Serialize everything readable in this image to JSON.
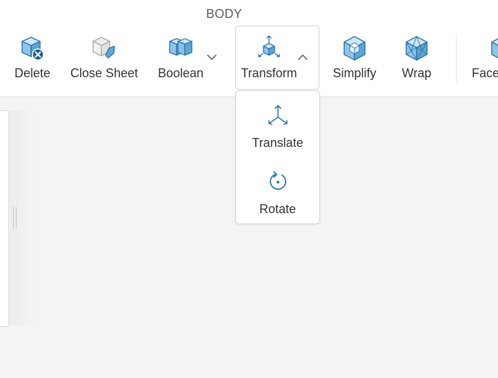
{
  "ribbon": {
    "group_title": "BODY",
    "tools": {
      "delete": {
        "label": "Delete",
        "icon": "cube-delete-icon"
      },
      "close_sheet": {
        "label": "Close Sheet",
        "icon": "close-sheet-icon"
      },
      "boolean": {
        "label": "Boolean",
        "icon": "boolean-icon"
      },
      "transform": {
        "label": "Transform",
        "icon": "transform-icon",
        "expanded": true
      },
      "simplify": {
        "label": "Simplify",
        "icon": "simplify-icon"
      },
      "wrap": {
        "label": "Wrap",
        "icon": "wrap-icon"
      },
      "faces": {
        "label": "Faces",
        "icon": "faces-icon"
      }
    }
  },
  "transform_menu": {
    "items": [
      {
        "label": "Translate",
        "icon": "translate-icon"
      },
      {
        "label": "Rotate",
        "icon": "rotate-icon"
      }
    ]
  },
  "colors": {
    "accent": "#2f74a8",
    "icon_fill": "#8ec6ea",
    "gray_icon": "#a9a9a9",
    "background": "#f4f4f4"
  }
}
